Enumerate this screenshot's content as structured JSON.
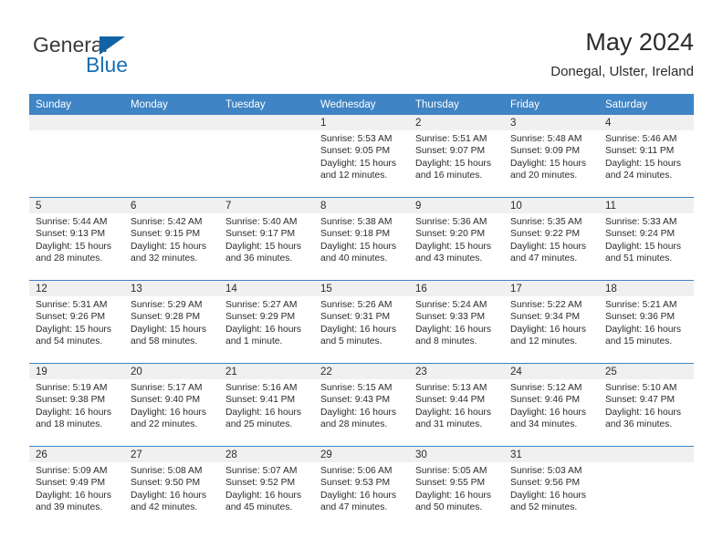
{
  "brand": {
    "name_part1": "General",
    "name_part2": "Blue",
    "accent_color": "#1a6fb5",
    "triangle_color": "#1263a5"
  },
  "header": {
    "title": "May 2024",
    "subtitle": "Donegal, Ulster, Ireland"
  },
  "calendar": {
    "header_bg": "#3f84c4",
    "header_text_color": "#ffffff",
    "daynum_bg": "#f0f0f0",
    "day_names": [
      "Sunday",
      "Monday",
      "Tuesday",
      "Wednesday",
      "Thursday",
      "Friday",
      "Saturday"
    ],
    "labels": {
      "sunrise": "Sunrise:",
      "sunset": "Sunset:",
      "daylight": "Daylight:"
    },
    "weeks": [
      [
        {
          "day": "",
          "empty": true
        },
        {
          "day": "",
          "empty": true
        },
        {
          "day": "",
          "empty": true
        },
        {
          "day": "1",
          "sunrise": "Sunrise: 5:53 AM",
          "sunset": "Sunset: 9:05 PM",
          "daylight_line1": "Daylight: 15 hours",
          "daylight_line2": "and 12 minutes."
        },
        {
          "day": "2",
          "sunrise": "Sunrise: 5:51 AM",
          "sunset": "Sunset: 9:07 PM",
          "daylight_line1": "Daylight: 15 hours",
          "daylight_line2": "and 16 minutes."
        },
        {
          "day": "3",
          "sunrise": "Sunrise: 5:48 AM",
          "sunset": "Sunset: 9:09 PM",
          "daylight_line1": "Daylight: 15 hours",
          "daylight_line2": "and 20 minutes."
        },
        {
          "day": "4",
          "sunrise": "Sunrise: 5:46 AM",
          "sunset": "Sunset: 9:11 PM",
          "daylight_line1": "Daylight: 15 hours",
          "daylight_line2": "and 24 minutes."
        }
      ],
      [
        {
          "day": "5",
          "sunrise": "Sunrise: 5:44 AM",
          "sunset": "Sunset: 9:13 PM",
          "daylight_line1": "Daylight: 15 hours",
          "daylight_line2": "and 28 minutes."
        },
        {
          "day": "6",
          "sunrise": "Sunrise: 5:42 AM",
          "sunset": "Sunset: 9:15 PM",
          "daylight_line1": "Daylight: 15 hours",
          "daylight_line2": "and 32 minutes."
        },
        {
          "day": "7",
          "sunrise": "Sunrise: 5:40 AM",
          "sunset": "Sunset: 9:17 PM",
          "daylight_line1": "Daylight: 15 hours",
          "daylight_line2": "and 36 minutes."
        },
        {
          "day": "8",
          "sunrise": "Sunrise: 5:38 AM",
          "sunset": "Sunset: 9:18 PM",
          "daylight_line1": "Daylight: 15 hours",
          "daylight_line2": "and 40 minutes."
        },
        {
          "day": "9",
          "sunrise": "Sunrise: 5:36 AM",
          "sunset": "Sunset: 9:20 PM",
          "daylight_line1": "Daylight: 15 hours",
          "daylight_line2": "and 43 minutes."
        },
        {
          "day": "10",
          "sunrise": "Sunrise: 5:35 AM",
          "sunset": "Sunset: 9:22 PM",
          "daylight_line1": "Daylight: 15 hours",
          "daylight_line2": "and 47 minutes."
        },
        {
          "day": "11",
          "sunrise": "Sunrise: 5:33 AM",
          "sunset": "Sunset: 9:24 PM",
          "daylight_line1": "Daylight: 15 hours",
          "daylight_line2": "and 51 minutes."
        }
      ],
      [
        {
          "day": "12",
          "sunrise": "Sunrise: 5:31 AM",
          "sunset": "Sunset: 9:26 PM",
          "daylight_line1": "Daylight: 15 hours",
          "daylight_line2": "and 54 minutes."
        },
        {
          "day": "13",
          "sunrise": "Sunrise: 5:29 AM",
          "sunset": "Sunset: 9:28 PM",
          "daylight_line1": "Daylight: 15 hours",
          "daylight_line2": "and 58 minutes."
        },
        {
          "day": "14",
          "sunrise": "Sunrise: 5:27 AM",
          "sunset": "Sunset: 9:29 PM",
          "daylight_line1": "Daylight: 16 hours",
          "daylight_line2": "and 1 minute."
        },
        {
          "day": "15",
          "sunrise": "Sunrise: 5:26 AM",
          "sunset": "Sunset: 9:31 PM",
          "daylight_line1": "Daylight: 16 hours",
          "daylight_line2": "and 5 minutes."
        },
        {
          "day": "16",
          "sunrise": "Sunrise: 5:24 AM",
          "sunset": "Sunset: 9:33 PM",
          "daylight_line1": "Daylight: 16 hours",
          "daylight_line2": "and 8 minutes."
        },
        {
          "day": "17",
          "sunrise": "Sunrise: 5:22 AM",
          "sunset": "Sunset: 9:34 PM",
          "daylight_line1": "Daylight: 16 hours",
          "daylight_line2": "and 12 minutes."
        },
        {
          "day": "18",
          "sunrise": "Sunrise: 5:21 AM",
          "sunset": "Sunset: 9:36 PM",
          "daylight_line1": "Daylight: 16 hours",
          "daylight_line2": "and 15 minutes."
        }
      ],
      [
        {
          "day": "19",
          "sunrise": "Sunrise: 5:19 AM",
          "sunset": "Sunset: 9:38 PM",
          "daylight_line1": "Daylight: 16 hours",
          "daylight_line2": "and 18 minutes."
        },
        {
          "day": "20",
          "sunrise": "Sunrise: 5:17 AM",
          "sunset": "Sunset: 9:40 PM",
          "daylight_line1": "Daylight: 16 hours",
          "daylight_line2": "and 22 minutes."
        },
        {
          "day": "21",
          "sunrise": "Sunrise: 5:16 AM",
          "sunset": "Sunset: 9:41 PM",
          "daylight_line1": "Daylight: 16 hours",
          "daylight_line2": "and 25 minutes."
        },
        {
          "day": "22",
          "sunrise": "Sunrise: 5:15 AM",
          "sunset": "Sunset: 9:43 PM",
          "daylight_line1": "Daylight: 16 hours",
          "daylight_line2": "and 28 minutes."
        },
        {
          "day": "23",
          "sunrise": "Sunrise: 5:13 AM",
          "sunset": "Sunset: 9:44 PM",
          "daylight_line1": "Daylight: 16 hours",
          "daylight_line2": "and 31 minutes."
        },
        {
          "day": "24",
          "sunrise": "Sunrise: 5:12 AM",
          "sunset": "Sunset: 9:46 PM",
          "daylight_line1": "Daylight: 16 hours",
          "daylight_line2": "and 34 minutes."
        },
        {
          "day": "25",
          "sunrise": "Sunrise: 5:10 AM",
          "sunset": "Sunset: 9:47 PM",
          "daylight_line1": "Daylight: 16 hours",
          "daylight_line2": "and 36 minutes."
        }
      ],
      [
        {
          "day": "26",
          "sunrise": "Sunrise: 5:09 AM",
          "sunset": "Sunset: 9:49 PM",
          "daylight_line1": "Daylight: 16 hours",
          "daylight_line2": "and 39 minutes."
        },
        {
          "day": "27",
          "sunrise": "Sunrise: 5:08 AM",
          "sunset": "Sunset: 9:50 PM",
          "daylight_line1": "Daylight: 16 hours",
          "daylight_line2": "and 42 minutes."
        },
        {
          "day": "28",
          "sunrise": "Sunrise: 5:07 AM",
          "sunset": "Sunset: 9:52 PM",
          "daylight_line1": "Daylight: 16 hours",
          "daylight_line2": "and 45 minutes."
        },
        {
          "day": "29",
          "sunrise": "Sunrise: 5:06 AM",
          "sunset": "Sunset: 9:53 PM",
          "daylight_line1": "Daylight: 16 hours",
          "daylight_line2": "and 47 minutes."
        },
        {
          "day": "30",
          "sunrise": "Sunrise: 5:05 AM",
          "sunset": "Sunset: 9:55 PM",
          "daylight_line1": "Daylight: 16 hours",
          "daylight_line2": "and 50 minutes."
        },
        {
          "day": "31",
          "sunrise": "Sunrise: 5:03 AM",
          "sunset": "Sunset: 9:56 PM",
          "daylight_line1": "Daylight: 16 hours",
          "daylight_line2": "and 52 minutes."
        },
        {
          "day": "",
          "empty": true
        }
      ]
    ]
  }
}
